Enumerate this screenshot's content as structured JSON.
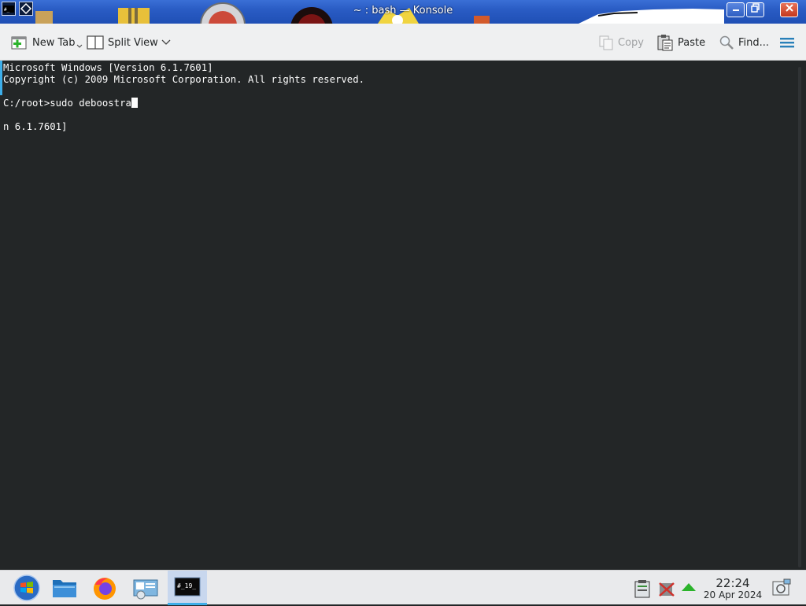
{
  "window": {
    "title": "~ : bash — Konsole"
  },
  "toolbar": {
    "new_tab_label": "New Tab",
    "split_view_label": "Split View",
    "copy_label": "Copy",
    "paste_label": "Paste",
    "find_label": "Find..."
  },
  "terminal": {
    "lines": [
      "Microsoft Windows [Version 6.1.7601]",
      "Copyright (c) 2009 Microsoft Corporation. All rights reserved.",
      "",
      "C:/root>sudo deboostra",
      "",
      "n 6.1.7601]"
    ],
    "prompt": "C:/root>",
    "command_input": "sudo deboostra"
  },
  "taskbar": {
    "apps": [
      "start-menu",
      "file-manager",
      "firefox",
      "network-settings",
      "konsole"
    ],
    "clock_time": "22:24",
    "clock_date": "20 Apr 2024"
  },
  "colors": {
    "terminal_bg": "#232627",
    "terminal_fg": "#fcfcfc",
    "accent": "#3daee9",
    "toolbar_bg": "#eff0f1",
    "titlebar_bg": "#2a5cc4"
  },
  "icons": {
    "new_tab": "new-tab-icon",
    "split_view": "split-view-icon",
    "copy": "copy-icon",
    "paste": "paste-icon",
    "find": "search-icon",
    "menu": "hamburger-menu-icon"
  }
}
